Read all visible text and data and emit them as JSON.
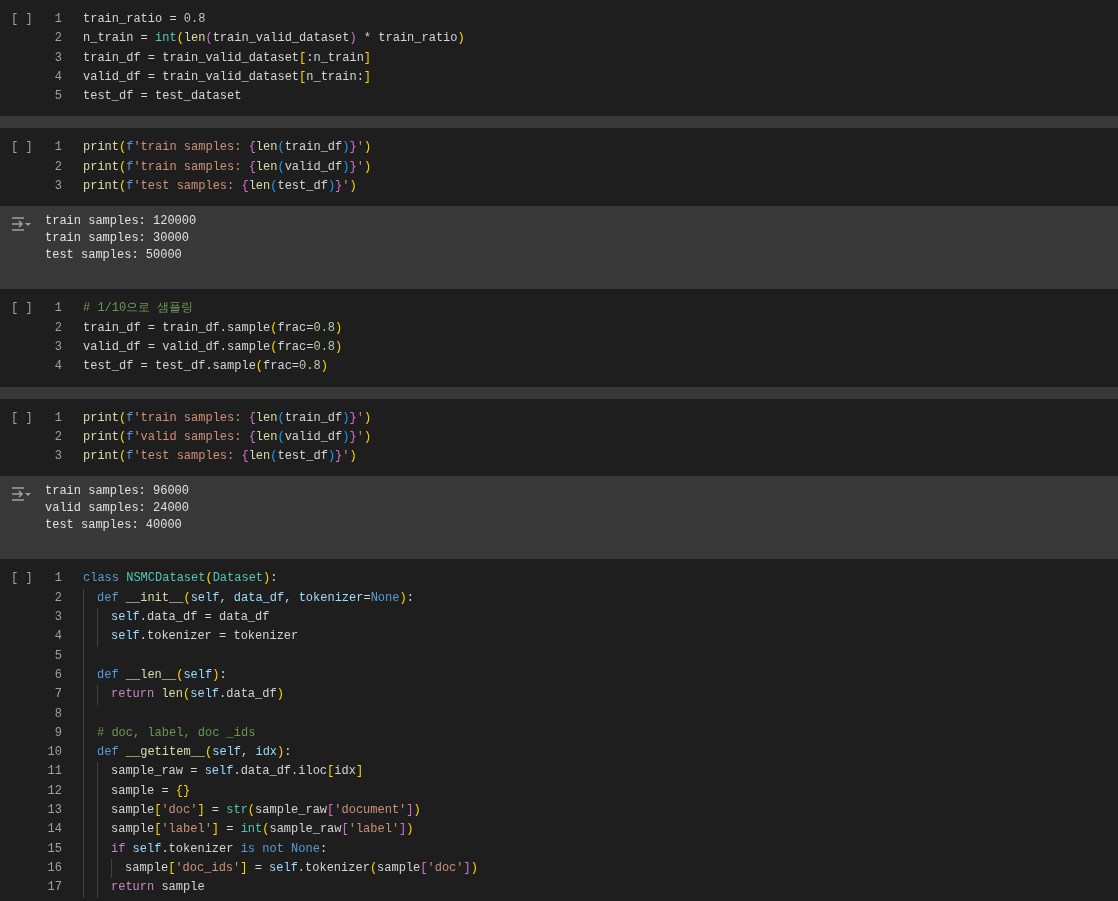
{
  "cells": [
    {
      "marker": "[ ]",
      "lines": [
        {
          "number": "1",
          "tokens": [
            {
              "text": "train_ratio = ",
              "kind": "plain"
            },
            {
              "text": "0.8",
              "kind": "num"
            }
          ]
        },
        {
          "number": "2",
          "tokens": [
            {
              "text": "n_train = ",
              "kind": "plain"
            },
            {
              "text": "int",
              "kind": "builtin"
            },
            {
              "text": "(",
              "kind": "br1"
            },
            {
              "text": "len",
              "kind": "func"
            },
            {
              "text": "(",
              "kind": "br2"
            },
            {
              "text": "train_valid_dataset",
              "kind": "plain"
            },
            {
              "text": ")",
              "kind": "br2"
            },
            {
              "text": " * train_ratio",
              "kind": "plain"
            },
            {
              "text": ")",
              "kind": "br1"
            }
          ]
        },
        {
          "number": "3",
          "tokens": [
            {
              "text": "train_df = train_valid_dataset",
              "kind": "plain"
            },
            {
              "text": "[",
              "kind": "br1"
            },
            {
              "text": ":n_train",
              "kind": "plain"
            },
            {
              "text": "]",
              "kind": "br1"
            }
          ]
        },
        {
          "number": "4",
          "tokens": [
            {
              "text": "valid_df = train_valid_dataset",
              "kind": "plain"
            },
            {
              "text": "[",
              "kind": "br1"
            },
            {
              "text": "n_train:",
              "kind": "plain"
            },
            {
              "text": "]",
              "kind": "br1"
            }
          ]
        },
        {
          "number": "5",
          "tokens": [
            {
              "text": "test_df = test_dataset",
              "kind": "plain"
            }
          ]
        }
      ]
    },
    {
      "marker": "[ ]",
      "lines": [
        {
          "number": "1",
          "tokens": [
            {
              "text": "print",
              "kind": "func"
            },
            {
              "text": "(",
              "kind": "br1"
            },
            {
              "text": "f",
              "kind": "kw"
            },
            {
              "text": "'train samples: ",
              "kind": "str"
            },
            {
              "text": "{",
              "kind": "br2"
            },
            {
              "text": "len",
              "kind": "func"
            },
            {
              "text": "(",
              "kind": "br3"
            },
            {
              "text": "train_df",
              "kind": "plain"
            },
            {
              "text": ")",
              "kind": "br3"
            },
            {
              "text": "}",
              "kind": "br2"
            },
            {
              "text": "'",
              "kind": "str"
            },
            {
              "text": ")",
              "kind": "br1"
            }
          ]
        },
        {
          "number": "2",
          "tokens": [
            {
              "text": "print",
              "kind": "func"
            },
            {
              "text": "(",
              "kind": "br1"
            },
            {
              "text": "f",
              "kind": "kw"
            },
            {
              "text": "'train samples: ",
              "kind": "str"
            },
            {
              "text": "{",
              "kind": "br2"
            },
            {
              "text": "len",
              "kind": "func"
            },
            {
              "text": "(",
              "kind": "br3"
            },
            {
              "text": "valid_df",
              "kind": "plain"
            },
            {
              "text": ")",
              "kind": "br3"
            },
            {
              "text": "}",
              "kind": "br2"
            },
            {
              "text": "'",
              "kind": "str"
            },
            {
              "text": ")",
              "kind": "br1"
            }
          ]
        },
        {
          "number": "3",
          "tokens": [
            {
              "text": "print",
              "kind": "func"
            },
            {
              "text": "(",
              "kind": "br1"
            },
            {
              "text": "f",
              "kind": "kw"
            },
            {
              "text": "'test samples: ",
              "kind": "str"
            },
            {
              "text": "{",
              "kind": "br2"
            },
            {
              "text": "len",
              "kind": "func"
            },
            {
              "text": "(",
              "kind": "br3"
            },
            {
              "text": "test_df",
              "kind": "plain"
            },
            {
              "text": ")",
              "kind": "br3"
            },
            {
              "text": "}",
              "kind": "br2"
            },
            {
              "text": "'",
              "kind": "str"
            },
            {
              "text": ")",
              "kind": "br1"
            }
          ]
        }
      ],
      "output": [
        "train samples: 120000",
        "train samples: 30000",
        "test samples: 50000"
      ]
    },
    {
      "marker": "[ ]",
      "lines": [
        {
          "number": "1",
          "tokens": [
            {
              "text": "# 1/10으로 샘플링",
              "kind": "comment"
            }
          ]
        },
        {
          "number": "2",
          "tokens": [
            {
              "text": "train_df = train_df.sample",
              "kind": "plain"
            },
            {
              "text": "(",
              "kind": "br1"
            },
            {
              "text": "frac=",
              "kind": "plain"
            },
            {
              "text": "0.8",
              "kind": "num"
            },
            {
              "text": ")",
              "kind": "br1"
            }
          ]
        },
        {
          "number": "3",
          "tokens": [
            {
              "text": "valid_df = valid_df.sample",
              "kind": "plain"
            },
            {
              "text": "(",
              "kind": "br1"
            },
            {
              "text": "frac=",
              "kind": "plain"
            },
            {
              "text": "0.8",
              "kind": "num"
            },
            {
              "text": ")",
              "kind": "br1"
            }
          ]
        },
        {
          "number": "4",
          "tokens": [
            {
              "text": "test_df = test_df.sample",
              "kind": "plain"
            },
            {
              "text": "(",
              "kind": "br1"
            },
            {
              "text": "frac=",
              "kind": "plain"
            },
            {
              "text": "0.8",
              "kind": "num"
            },
            {
              "text": ")",
              "kind": "br1"
            }
          ]
        }
      ]
    },
    {
      "marker": "[ ]",
      "lines": [
        {
          "number": "1",
          "tokens": [
            {
              "text": "print",
              "kind": "func"
            },
            {
              "text": "(",
              "kind": "br1"
            },
            {
              "text": "f",
              "kind": "kw"
            },
            {
              "text": "'train samples: ",
              "kind": "str"
            },
            {
              "text": "{",
              "kind": "br2"
            },
            {
              "text": "len",
              "kind": "func"
            },
            {
              "text": "(",
              "kind": "br3"
            },
            {
              "text": "train_df",
              "kind": "plain"
            },
            {
              "text": ")",
              "kind": "br3"
            },
            {
              "text": "}",
              "kind": "br2"
            },
            {
              "text": "'",
              "kind": "str"
            },
            {
              "text": ")",
              "kind": "br1"
            }
          ]
        },
        {
          "number": "2",
          "tokens": [
            {
              "text": "print",
              "kind": "func"
            },
            {
              "text": "(",
              "kind": "br1"
            },
            {
              "text": "f",
              "kind": "kw"
            },
            {
              "text": "'valid samples: ",
              "kind": "str"
            },
            {
              "text": "{",
              "kind": "br2"
            },
            {
              "text": "len",
              "kind": "func"
            },
            {
              "text": "(",
              "kind": "br3"
            },
            {
              "text": "valid_df",
              "kind": "plain"
            },
            {
              "text": ")",
              "kind": "br3"
            },
            {
              "text": "}",
              "kind": "br2"
            },
            {
              "text": "'",
              "kind": "str"
            },
            {
              "text": ")",
              "kind": "br1"
            }
          ]
        },
        {
          "number": "3",
          "tokens": [
            {
              "text": "print",
              "kind": "func"
            },
            {
              "text": "(",
              "kind": "br1"
            },
            {
              "text": "f",
              "kind": "kw"
            },
            {
              "text": "'test samples: ",
              "kind": "str"
            },
            {
              "text": "{",
              "kind": "br2"
            },
            {
              "text": "len",
              "kind": "func"
            },
            {
              "text": "(",
              "kind": "br3"
            },
            {
              "text": "test_df",
              "kind": "plain"
            },
            {
              "text": ")",
              "kind": "br3"
            },
            {
              "text": "}",
              "kind": "br2"
            },
            {
              "text": "'",
              "kind": "str"
            },
            {
              "text": ")",
              "kind": "br1"
            }
          ]
        }
      ],
      "output": [
        "train samples: 96000",
        "valid samples: 24000",
        "test samples: 40000"
      ]
    },
    {
      "marker": "[ ]",
      "lines": [
        {
          "number": "1",
          "tokens": [
            {
              "text": "class",
              "kind": "kw"
            },
            {
              "text": " NSMCDataset",
              "kind": "cls"
            },
            {
              "text": "(",
              "kind": "br1"
            },
            {
              "text": "Dataset",
              "kind": "cls"
            },
            {
              "text": ")",
              "kind": "br1"
            },
            {
              "text": ":",
              "kind": "plain"
            }
          ],
          "children": [
            {
              "number": "2",
              "tokens": [
                {
                  "text": "def",
                  "kind": "kw"
                },
                {
                  "text": " __init__",
                  "kind": "func"
                },
                {
                  "text": "(",
                  "kind": "br1"
                },
                {
                  "text": "self, data_df, tokenizer",
                  "kind": "var"
                },
                {
                  "text": "=",
                  "kind": "plain"
                },
                {
                  "text": "None",
                  "kind": "kw"
                },
                {
                  "text": ")",
                  "kind": "br1"
                },
                {
                  "text": ":",
                  "kind": "plain"
                }
              ],
              "children": [
                {
                  "number": "3",
                  "tokens": [
                    {
                      "text": "self",
                      "kind": "var"
                    },
                    {
                      "text": ".data_df = data_df",
                      "kind": "plain"
                    }
                  ]
                },
                {
                  "number": "4",
                  "tokens": [
                    {
                      "text": "self",
                      "kind": "var"
                    },
                    {
                      "text": ".tokenizer = tokenizer",
                      "kind": "plain"
                    }
                  ]
                }
              ]
            },
            {
              "number": "5"
            },
            {
              "number": "6",
              "tokens": [
                {
                  "text": "def",
                  "kind": "kw"
                },
                {
                  "text": " __len__",
                  "kind": "func"
                },
                {
                  "text": "(",
                  "kind": "br1"
                },
                {
                  "text": "self",
                  "kind": "var"
                },
                {
                  "text": ")",
                  "kind": "br1"
                },
                {
                  "text": ":",
                  "kind": "plain"
                }
              ],
              "children": [
                {
                  "number": "7",
                  "tokens": [
                    {
                      "text": "return",
                      "kind": "ctrl"
                    },
                    {
                      "text": " len",
                      "kind": "func"
                    },
                    {
                      "text": "(",
                      "kind": "br1"
                    },
                    {
                      "text": "self",
                      "kind": "var"
                    },
                    {
                      "text": ".data_df",
                      "kind": "plain"
                    },
                    {
                      "text": ")",
                      "kind": "br1"
                    }
                  ]
                }
              ]
            },
            {
              "number": "8"
            },
            {
              "number": "9",
              "tokens": [
                {
                  "text": "# doc, label, doc _ids",
                  "kind": "comment"
                }
              ]
            },
            {
              "number": "10",
              "tokens": [
                {
                  "text": "def",
                  "kind": "kw"
                },
                {
                  "text": " __getitem__",
                  "kind": "func"
                },
                {
                  "text": "(",
                  "kind": "br1"
                },
                {
                  "text": "self, idx",
                  "kind": "var"
                },
                {
                  "text": ")",
                  "kind": "br1"
                },
                {
                  "text": ":",
                  "kind": "plain"
                }
              ],
              "children": [
                {
                  "number": "11",
                  "tokens": [
                    {
                      "text": "sample_raw = ",
                      "kind": "plain"
                    },
                    {
                      "text": "self",
                      "kind": "var"
                    },
                    {
                      "text": ".data_df.iloc",
                      "kind": "plain"
                    },
                    {
                      "text": "[",
                      "kind": "br1"
                    },
                    {
                      "text": "idx",
                      "kind": "plain"
                    },
                    {
                      "text": "]",
                      "kind": "br1"
                    }
                  ]
                },
                {
                  "number": "12",
                  "tokens": [
                    {
                      "text": "sample = ",
                      "kind": "plain"
                    },
                    {
                      "text": "{}",
                      "kind": "br1"
                    }
                  ]
                },
                {
                  "number": "13",
                  "tokens": [
                    {
                      "text": "sample",
                      "kind": "plain"
                    },
                    {
                      "text": "[",
                      "kind": "br1"
                    },
                    {
                      "text": "'doc'",
                      "kind": "str"
                    },
                    {
                      "text": "]",
                      "kind": "br1"
                    },
                    {
                      "text": " = ",
                      "kind": "plain"
                    },
                    {
                      "text": "str",
                      "kind": "builtin"
                    },
                    {
                      "text": "(",
                      "kind": "br1"
                    },
                    {
                      "text": "sample_raw",
                      "kind": "plain"
                    },
                    {
                      "text": "[",
                      "kind": "br2"
                    },
                    {
                      "text": "'document'",
                      "kind": "str"
                    },
                    {
                      "text": "]",
                      "kind": "br2"
                    },
                    {
                      "text": ")",
                      "kind": "br1"
                    }
                  ]
                },
                {
                  "number": "14",
                  "tokens": [
                    {
                      "text": "sample",
                      "kind": "plain"
                    },
                    {
                      "text": "[",
                      "kind": "br1"
                    },
                    {
                      "text": "'label'",
                      "kind": "str"
                    },
                    {
                      "text": "]",
                      "kind": "br1"
                    },
                    {
                      "text": " = ",
                      "kind": "plain"
                    },
                    {
                      "text": "int",
                      "kind": "builtin"
                    },
                    {
                      "text": "(",
                      "kind": "br1"
                    },
                    {
                      "text": "sample_raw",
                      "kind": "plain"
                    },
                    {
                      "text": "[",
                      "kind": "br2"
                    },
                    {
                      "text": "'label'",
                      "kind": "str"
                    },
                    {
                      "text": "]",
                      "kind": "br2"
                    },
                    {
                      "text": ")",
                      "kind": "br1"
                    }
                  ]
                },
                {
                  "number": "15",
                  "tokens": [
                    {
                      "text": "if",
                      "kind": "ctrl"
                    },
                    {
                      "text": " self",
                      "kind": "var"
                    },
                    {
                      "text": ".tokenizer ",
                      "kind": "plain"
                    },
                    {
                      "text": "is not",
                      "kind": "kw"
                    },
                    {
                      "text": " None",
                      "kind": "kw"
                    },
                    {
                      "text": ":",
                      "kind": "plain"
                    }
                  ],
                  "children": [
                    {
                      "number": "16",
                      "tokens": [
                        {
                          "text": "sample",
                          "kind": "plain"
                        },
                        {
                          "text": "[",
                          "kind": "br1"
                        },
                        {
                          "text": "'doc_ids'",
                          "kind": "str"
                        },
                        {
                          "text": "]",
                          "kind": "br1"
                        },
                        {
                          "text": " = ",
                          "kind": "plain"
                        },
                        {
                          "text": "self",
                          "kind": "var"
                        },
                        {
                          "text": ".tokenizer",
                          "kind": "plain"
                        },
                        {
                          "text": "(",
                          "kind": "br1"
                        },
                        {
                          "text": "sample",
                          "kind": "plain"
                        },
                        {
                          "text": "[",
                          "kind": "br2"
                        },
                        {
                          "text": "'doc'",
                          "kind": "str"
                        },
                        {
                          "text": "]",
                          "kind": "br2"
                        },
                        {
                          "text": ")",
                          "kind": "br1"
                        }
                      ]
                    }
                  ]
                },
                {
                  "number": "17",
                  "tokens": [
                    {
                      "text": "return",
                      "kind": "ctrl"
                    },
                    {
                      "text": " sample",
                      "kind": "plain"
                    }
                  ]
                }
              ]
            }
          ]
        }
      ]
    }
  ]
}
